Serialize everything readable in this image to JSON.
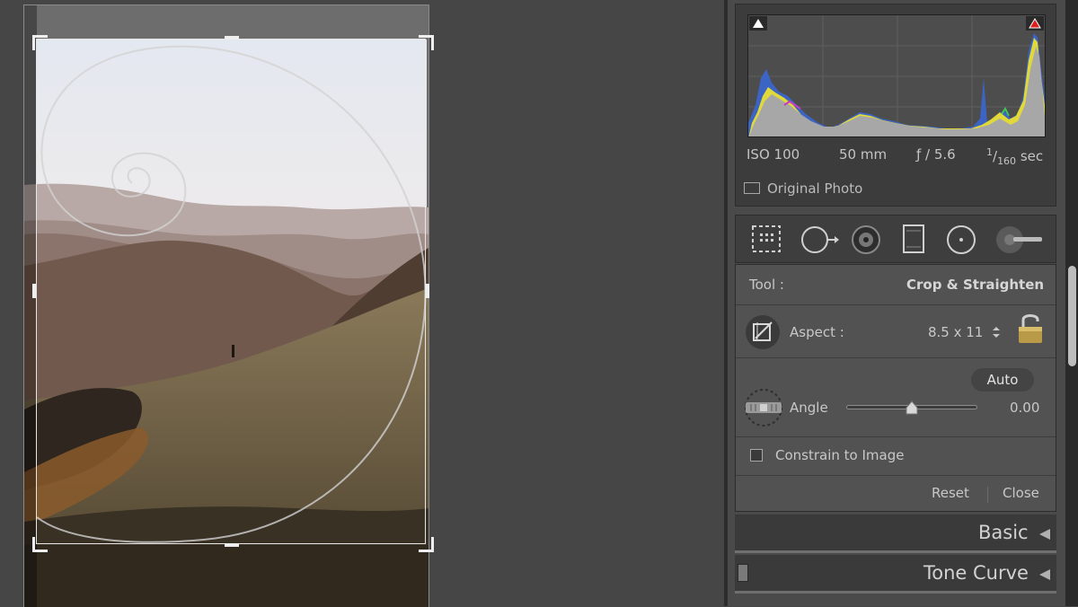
{
  "photo": {
    "colors": {
      "sky": "#f1eef1",
      "ridge_far": "#a99c9a",
      "hill_mid": "#7b6355",
      "slope": "#7a6b4c",
      "foreground": "#2c241c",
      "spiral": "#cfcfcf"
    }
  },
  "histogram": {
    "shadow_clip_color": "#ffffff",
    "highlight_clip_color": "#e01c1c",
    "iso": "ISO 100",
    "focal_length": "50 mm",
    "aperture": "ƒ / 5.6",
    "shutter_numerator": "1",
    "shutter_denominator": "160",
    "shutter_unit": "sec",
    "original_photo_label": "Original Photo"
  },
  "toolstrip": {
    "tools": [
      "crop-overlay-tool",
      "spot-removal-tool",
      "red-eye-tool",
      "graduated-filter-tool",
      "radial-filter-tool",
      "adjustment-brush-tool"
    ]
  },
  "crop": {
    "tool_label": "Tool :",
    "tool_value": "Crop & Straighten",
    "aspect_label": "Aspect :",
    "aspect_value": "8.5 x 11",
    "auto_label": "Auto",
    "angle_label": "Angle",
    "angle_value": "0.00",
    "angle_slider_fraction": 0.5,
    "constrain_label": "Constrain to Image",
    "constrain_checked": false,
    "reset_label": "Reset",
    "close_label": "Close"
  },
  "sections": {
    "basic": "Basic",
    "tone_curve": "Tone Curve"
  }
}
